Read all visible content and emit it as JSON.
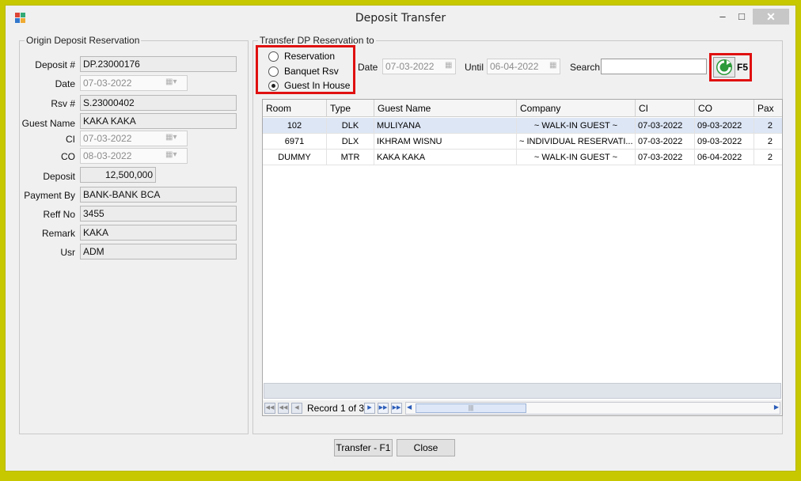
{
  "window": {
    "title": "Deposit Transfer"
  },
  "origin": {
    "group_title": "Origin Deposit Reservation",
    "fields": {
      "deposit_no": {
        "label": "Deposit #",
        "value": "DP.23000176"
      },
      "date": {
        "label": "Date",
        "value": "07-03-2022"
      },
      "rsv_no": {
        "label": "Rsv #",
        "value": "S.23000402"
      },
      "guest_name": {
        "label": "Guest Name",
        "value": "KAKA KAKA"
      },
      "ci": {
        "label": "CI",
        "value": "07-03-2022"
      },
      "co": {
        "label": "CO",
        "value": "08-03-2022"
      },
      "deposit": {
        "label": "Deposit",
        "value": "12,500,000"
      },
      "payment_by": {
        "label": "Payment By",
        "value": "BANK-BANK BCA"
      },
      "reff_no": {
        "label": "Reff No",
        "value": "3455"
      },
      "remark": {
        "label": "Remark",
        "value": "KAKA"
      },
      "usr": {
        "label": "Usr",
        "value": "ADM"
      }
    }
  },
  "transfer": {
    "group_title": "Transfer DP Reservation to",
    "options": [
      {
        "label": "Reservation",
        "checked": false
      },
      {
        "label": "Banquet Rsv",
        "checked": false
      },
      {
        "label": "Guest In House",
        "checked": true
      }
    ],
    "date_label": "Date",
    "date_value": "07-03-2022",
    "until_label": "Until",
    "until_value": "06-04-2022",
    "search_label": "Search",
    "search_value": "",
    "refresh_key": "F5"
  },
  "grid": {
    "columns": [
      "Room",
      "Type",
      "Guest Name",
      "Company",
      "CI",
      "CO",
      "Pax"
    ],
    "rows": [
      {
        "room": "102",
        "type": "DLK",
        "guest": "MULIYANA",
        "company": "~ WALK-IN GUEST ~",
        "ci": "07-03-2022",
        "co": "09-03-2022",
        "pax": "2"
      },
      {
        "room": "6971",
        "type": "DLX",
        "guest": "IKHRAM WISNU",
        "company": "~ INDIVIDUAL RESERVATI...",
        "ci": "07-03-2022",
        "co": "09-03-2022",
        "pax": "2"
      },
      {
        "room": "DUMMY",
        "type": "MTR",
        "guest": "KAKA KAKA",
        "company": "~ WALK-IN GUEST ~",
        "ci": "07-03-2022",
        "co": "06-04-2022",
        "pax": "2"
      }
    ],
    "record_text": "Record 1 of 3"
  },
  "buttons": {
    "transfer": "Transfer - F1",
    "close": "Close"
  },
  "icons": {
    "calendar": "calendar-dropdown-icon",
    "refresh": "refresh-icon",
    "app": "app-icon"
  },
  "colors": {
    "highlight": "#e01010",
    "selected_row": "#dde6f5",
    "refresh_green": "#2c9a3a"
  }
}
